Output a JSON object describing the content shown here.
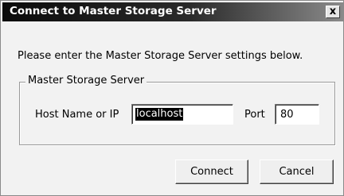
{
  "window": {
    "title": "Connect to Master Storage Server",
    "close_glyph": "x"
  },
  "instruction": "Please enter the Master Storage Server settings below.",
  "group": {
    "legend": "Master Storage Server",
    "host_label": "Host Name or IP",
    "host_value": "localhost",
    "port_label": "Port",
    "port_value": "80"
  },
  "buttons": {
    "connect": "Connect",
    "cancel": "Cancel"
  }
}
